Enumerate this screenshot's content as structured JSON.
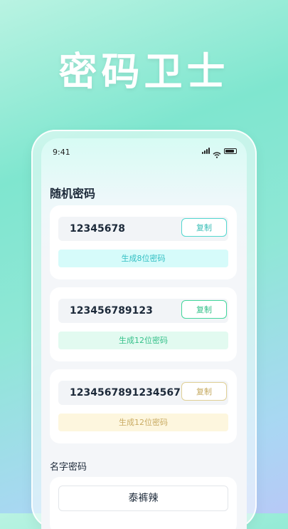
{
  "hero_title": "密码卫士",
  "status": {
    "time": "9:41"
  },
  "random_section": {
    "title": "随机密码",
    "cards": [
      {
        "password": "12345678",
        "copy_label": "复制",
        "generate_label": "生成8位密码"
      },
      {
        "password": "123456789123",
        "copy_label": "复制",
        "generate_label": "生成12位密码"
      },
      {
        "password": "1234567891234567",
        "copy_label": "复制",
        "generate_label": "生成12位密码"
      }
    ]
  },
  "name_section": {
    "title": "名字密码",
    "name_value": "泰裤辣"
  },
  "colors": {
    "card1_accent": "#53d7cf",
    "card2_accent": "#42d69c",
    "card3_accent": "#e0d096"
  },
  "icons": [
    "signal-icon",
    "wifi-icon",
    "battery-icon"
  ]
}
